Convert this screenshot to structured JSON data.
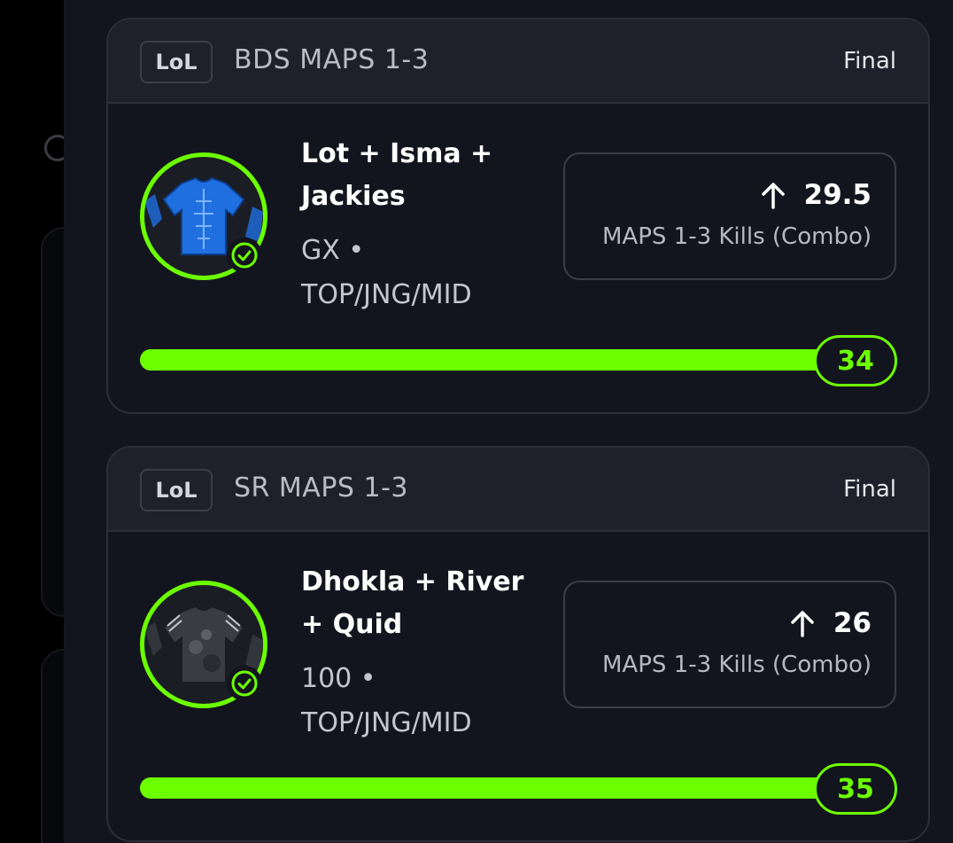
{
  "colors": {
    "accent": "#6cff00",
    "background": "#13151e",
    "header": "#1e212b",
    "border": "#2b2e38"
  },
  "cards": [
    {
      "game_badge": "LoL",
      "league": "BDS MAPS 1-3",
      "status": "Final",
      "players": "Lot + Isma + Jackies",
      "team": "GX •",
      "positions": "TOP/JNG/MID",
      "pick_direction_icon": "arrow-up-icon",
      "line": "29.5",
      "stat": "MAPS 1-3 Kills (Combo)",
      "result": "34",
      "progress": 1.0,
      "jersey_color": "#1f6fe0",
      "hit": true
    },
    {
      "game_badge": "LoL",
      "league": "SR MAPS 1-3",
      "status": "Final",
      "players": "Dhokla + River + Quid",
      "team": "100 •",
      "positions": "TOP/JNG/MID",
      "pick_direction_icon": "arrow-up-icon",
      "line": "26",
      "stat": "MAPS 1-3 Kills (Combo)",
      "result": "35",
      "progress": 1.0,
      "jersey_color": "#3a3c44",
      "hit": true
    }
  ]
}
